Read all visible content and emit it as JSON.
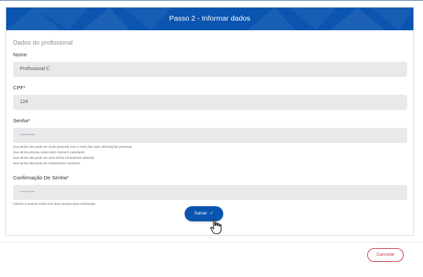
{
  "header": {
    "title": "Passo 2 - Informar dados"
  },
  "section": {
    "title": "Dados do profissional"
  },
  "fields": {
    "nome": {
      "label": "Nome",
      "value": "Profissional C"
    },
    "cpf": {
      "label": "CPF*",
      "value": "124"
    },
    "senha": {
      "label": "Senha*",
      "value": "••••••••",
      "hints": [
        "Sua senha não pode ser muito parecida com o resto das suas informações pessoais.",
        "Sua senha precisa conter pelo menos 8 caracteres.",
        "Sua senha não pode ser uma senha comumente utilizada.",
        "Sua senha não pode ser inteiramente numérica."
      ]
    },
    "confirmacao": {
      "label": "Confirmação De Senha*",
      "value": "••••••••",
      "hint": "Informe a mesma senha nos dois campos para verificação."
    }
  },
  "actions": {
    "save_label": "Salvar",
    "save_icon": "✓",
    "cancel_label": "Cancelar"
  },
  "colors": {
    "primary": "#0b55b0",
    "cancel": "#c8323a",
    "input_bg": "#e8e9eb"
  }
}
